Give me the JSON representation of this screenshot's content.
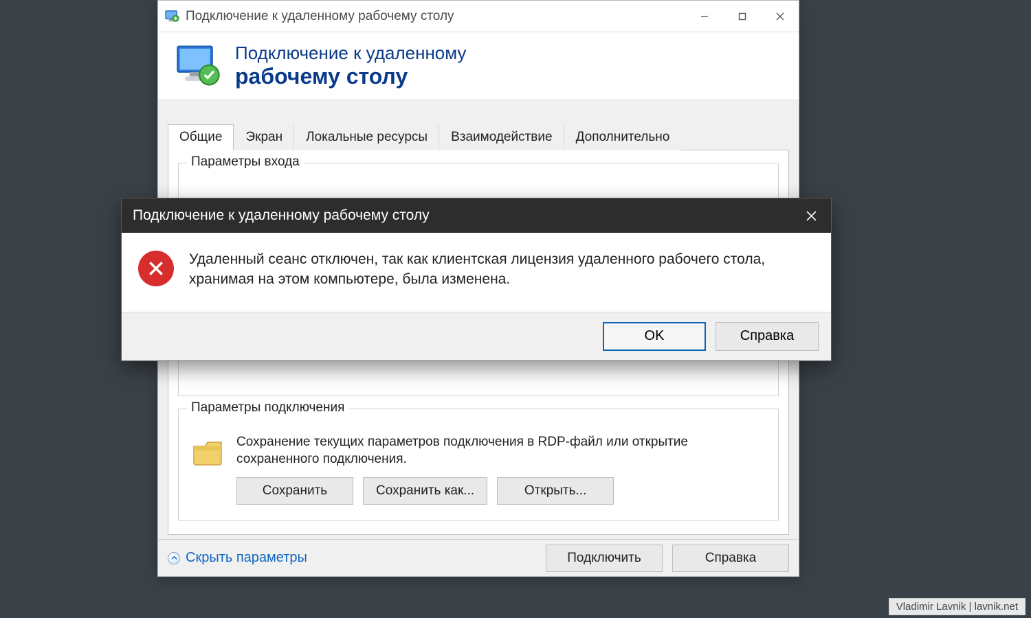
{
  "main_window": {
    "title": "Подключение к удаленному рабочему столу",
    "banner": {
      "line1": "Подключение к удаленному",
      "line2": "рабочему столу"
    },
    "tabs": [
      {
        "label": "Общие",
        "active": true
      },
      {
        "label": "Экран",
        "active": false
      },
      {
        "label": "Локальные ресурсы",
        "active": false
      },
      {
        "label": "Взаимодействие",
        "active": false
      },
      {
        "label": "Дополнительно",
        "active": false
      }
    ],
    "login_group": {
      "legend": "Параметры входа"
    },
    "connection_group": {
      "legend": "Параметры подключения",
      "description": "Сохранение текущих параметров подключения в RDP-файл или открытие сохраненного подключения.",
      "buttons": {
        "save": "Сохранить",
        "save_as": "Сохранить как...",
        "open": "Открыть..."
      }
    },
    "bottom": {
      "toggle_label": "Скрыть параметры",
      "connect": "Подключить",
      "help": "Справка"
    }
  },
  "error_dialog": {
    "title": "Подключение к удаленному рабочему столу",
    "message": "Удаленный сеанс отключен, так как клиентская лицензия удаленного рабочего стола, хранимая на этом компьютере, была изменена.",
    "buttons": {
      "ok": "OK",
      "help": "Справка"
    }
  },
  "watermark": "Vladimir Lavnik | lavnik.net"
}
